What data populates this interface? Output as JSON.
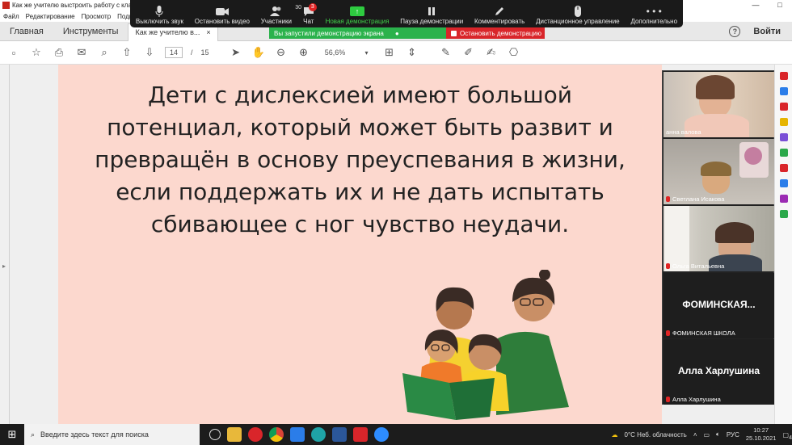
{
  "window": {
    "title": "Как же учителю выстроить работу с класс",
    "controls": [
      "—",
      "□"
    ]
  },
  "menu": [
    "Файл",
    "Редактирование",
    "Просмотр",
    "Подп"
  ],
  "tabs": {
    "home": "Главная",
    "tools": "Инструменты",
    "doc_tab": "Как же учителю в...",
    "doc_close": "×",
    "signin": "Войти",
    "help": "?"
  },
  "zoom_toolbar": {
    "items": [
      {
        "label": "Выключить звук",
        "icon": "microphone-icon"
      },
      {
        "label": "Остановить видео",
        "icon": "video-camera-icon"
      },
      {
        "label": "Участники",
        "icon": "participants-icon",
        "count": "30"
      },
      {
        "label": "Чат",
        "icon": "chat-icon",
        "badge": "3"
      },
      {
        "label": "Новая демонстрация",
        "icon": "share-screen-icon"
      },
      {
        "label": "Пауза демонстрации",
        "icon": "pause-icon"
      },
      {
        "label": "Комментировать",
        "icon": "annotate-icon"
      },
      {
        "label": "Дистанционное управление",
        "icon": "remote-control-icon"
      },
      {
        "label": "Дополнительно",
        "icon": "more-icon"
      }
    ]
  },
  "share_banner": {
    "status": "Вы запустили демонстрацию экрана",
    "stop": "Остановить демонстрацию"
  },
  "pdf_toolbar": {
    "page_current": "14",
    "page_sep": "/",
    "page_total": "15",
    "zoom": "56,6%"
  },
  "slide": {
    "lines": [
      "Дети с дислексией имеют большой",
      "потенциал, который может быть развит и",
      "превращён в основу преуспевания в жизни,",
      "если поддержать их и не дать испытать",
      "сбивающее с ног чувство неудачи."
    ]
  },
  "participants": [
    {
      "name": "анна валова",
      "muted": false
    },
    {
      "name": "Светлана Исакова",
      "muted": true
    },
    {
      "name": "Ольга Витальевна",
      "muted": true
    },
    {
      "name": "ФОМИНСКАЯ ШКОЛА",
      "display": "ФОМИНСКАЯ...",
      "muted": true
    },
    {
      "name": "Алла Харлушина",
      "display": "Алла Харлушина",
      "muted": true
    }
  ],
  "taskbar": {
    "search_placeholder": "Введите здесь текст для поиска",
    "weather": "0°C  Неб. облачность",
    "lang": "РУС",
    "time": "10:27",
    "date": "25.10.2021",
    "notif": "4"
  },
  "colors": {
    "slide_bg": "#fcd8ce",
    "zoom_toolbar": "#1a1a1a",
    "share_green": "#2bb24c",
    "stop_red": "#d9252a"
  }
}
